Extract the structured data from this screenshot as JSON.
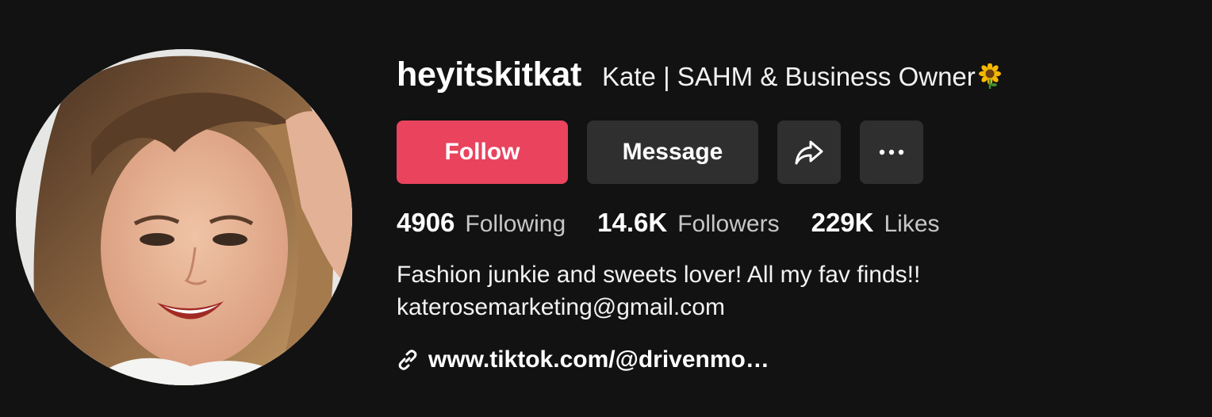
{
  "profile": {
    "username": "heyitskitkat",
    "nickname": "Kate | SAHM & Business Owner",
    "nickname_emoji": "sunflower-emoji",
    "avatar": "profile-avatar-photo"
  },
  "actions": {
    "follow_label": "Follow",
    "message_label": "Message",
    "share_icon": "share-icon",
    "more_icon": "more-icon"
  },
  "stats": {
    "following_count": "4906",
    "following_label": "Following",
    "followers_count": "14.6K",
    "followers_label": "Followers",
    "likes_count": "229K",
    "likes_label": "Likes"
  },
  "bio": {
    "line1": "Fashion junkie and sweets lover! All my fav finds!!",
    "line2": "katerosemarketing@gmail.com"
  },
  "link": {
    "icon": "link-icon",
    "text": "www.tiktok.com/@drivenmo…"
  },
  "colors": {
    "background": "#121212",
    "follow_button": "#e9435e",
    "secondary_button": "#2f2f2f",
    "muted_text": "#c7c7c7"
  }
}
